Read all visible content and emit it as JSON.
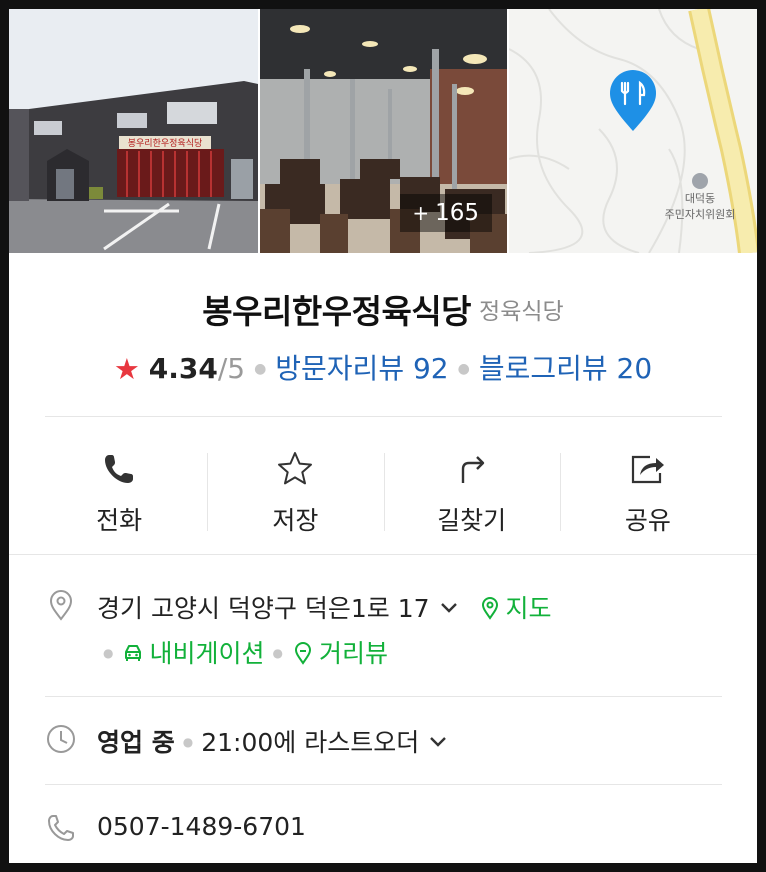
{
  "photos": {
    "more_count": "165",
    "more_prefix": "+",
    "map_label_line1": "대덕동",
    "map_label_line2": "주민자치위원회",
    "sign_text": "봉우리한우정육식당"
  },
  "place": {
    "name": "봉우리한우정육식당",
    "category": "정육식당"
  },
  "rating": {
    "value": "4.34",
    "max": "/5",
    "visitor_reviews": "방문자리뷰 92",
    "blog_reviews": "블로그리뷰 20"
  },
  "actions": [
    {
      "label": "전화",
      "icon": "phone-icon"
    },
    {
      "label": "저장",
      "icon": "star-outline-icon"
    },
    {
      "label": "길찾기",
      "icon": "directions-icon"
    },
    {
      "label": "공유",
      "icon": "share-icon"
    }
  ],
  "address": {
    "text": "경기 고양시 덕양구 덕은1로 17",
    "map_link": "지도",
    "navigation_link": "내비게이션",
    "street_view_link": "거리뷰"
  },
  "hours": {
    "status": "영업 중",
    "detail": "21:00에 라스트오더"
  },
  "phone": {
    "number": "0507-1489-6701"
  },
  "colors": {
    "star": "#e8373f",
    "link_blue": "#1f63b6",
    "link_green": "#12b13a",
    "map_pin": "#1e90e6",
    "map_road": "#f3e49a"
  }
}
